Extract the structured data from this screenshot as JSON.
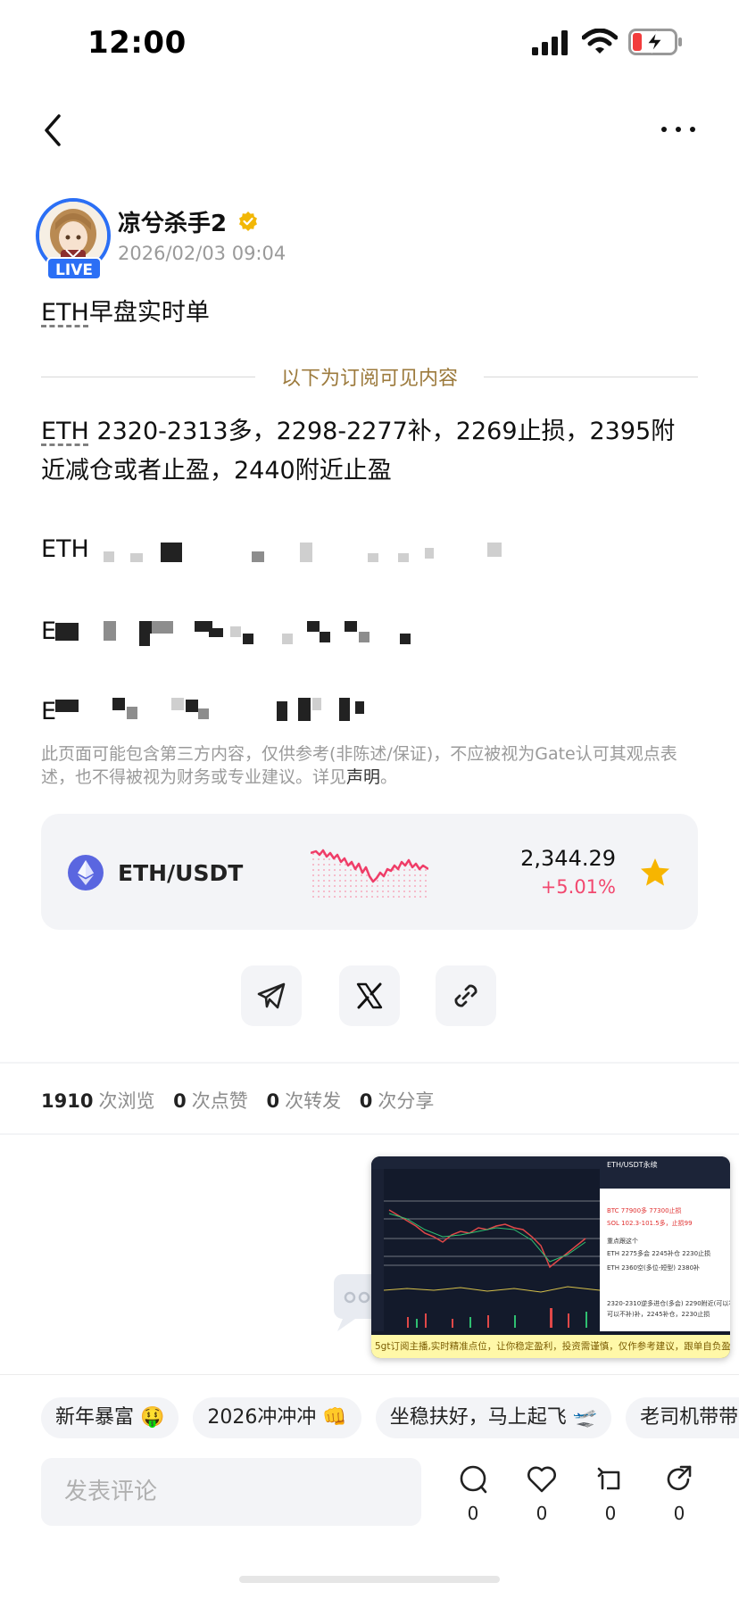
{
  "status_bar": {
    "time": "12:00"
  },
  "author": {
    "name": "凉兮杀手2",
    "date": "2026/02/03 09:04",
    "live_label": "LIVE"
  },
  "post": {
    "title_term": "ETH",
    "title_rest": "早盘实时单",
    "divider_text": "以下为订阅可见内容",
    "content_term": "ETH",
    "content_rest": " 2320-2313多，2298-2277补，2269止损，2395附近减仓或者止盈，2440附近止盈",
    "blurred_prefixes": [
      "ETH",
      "E",
      "E"
    ]
  },
  "disclaimer": {
    "text": "此页面可能包含第三方内容，仅供参考(非陈述/保证)，不应被视为Gate认可其观点表述，也不得被视为财务或专业建议。详见",
    "link": "声明",
    "tail": "。"
  },
  "ticker": {
    "symbol": "ETH/USDT",
    "price": "2,344.29",
    "change": "+5.01%",
    "colors": {
      "change": "#f2486f",
      "star": "#f7b500"
    }
  },
  "share": {
    "items": [
      "telegram-icon",
      "x-icon",
      "link-icon"
    ]
  },
  "stats": {
    "views": "1910",
    "views_label": "次浏览",
    "likes": "0",
    "likes_label": "次点赞",
    "reposts": "0",
    "reposts_label": "次转发",
    "shares": "0",
    "shares_label": "次分享"
  },
  "video": {
    "caption": "5gt订阅主播,实时精准点位，让你稳定盈利，投资需谨慎，仅作参考建议，跟单自负盈亏",
    "title": "ETH/USDT永续",
    "panel_lines": [
      "BTC 77900多 77300止损",
      "SOL 102.3-101.5多，止损99",
      "重点跟这个",
      "ETH 2275多会 2245补仓 2230止损",
      "ETH 2360空(多位-短型) 2380补",
      "2320-2310逆多进仓(多会) 2290附近(可以补，但",
      "可以不补)补，2245补仓，2230止损"
    ]
  },
  "chips": [
    "新年暴富 🤑",
    "2026冲冲冲 👊",
    "坐稳扶好，马上起飞 🛫",
    "老司机带带我"
  ],
  "comment": {
    "placeholder": "发表评论"
  },
  "actions": {
    "comments": "0",
    "likes": "0",
    "reposts": "0",
    "shares": "0"
  },
  "colors": {
    "accent": "#2b6ff5",
    "divider_text": "#9c7a3c"
  }
}
